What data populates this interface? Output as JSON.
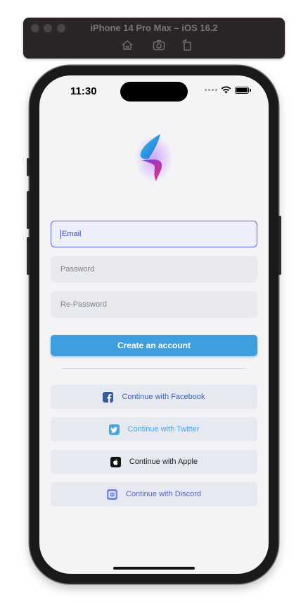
{
  "simulator": {
    "title": "iPhone 14 Pro Max – iOS 16.2",
    "toolbar": [
      "home-icon",
      "screenshot-icon",
      "rotate-icon"
    ]
  },
  "status_bar": {
    "time": "11:30"
  },
  "form": {
    "email": {
      "placeholder": "Email",
      "value": ""
    },
    "password": {
      "placeholder": "Password",
      "value": ""
    },
    "re_password": {
      "placeholder": "Re-Password",
      "value": ""
    },
    "submit_label": "Create an account"
  },
  "social": [
    {
      "label": "Continue with Facebook",
      "icon": "facebook-icon",
      "color": "#3b5ea8"
    },
    {
      "label": "Continue with Twitter",
      "icon": "twitter-icon",
      "color": "#4aa3df"
    },
    {
      "label": "Continue with Apple",
      "icon": "apple-icon",
      "color": "#1b1c2a"
    },
    {
      "label": "Continue with Discord",
      "icon": "discord-icon",
      "color": "#5662c4"
    }
  ],
  "colors": {
    "accent": "#3f9ede",
    "focus_border": "#5b67d8",
    "field_bg": "#e9eaf0",
    "screen_bg": "#f4f4f6"
  }
}
